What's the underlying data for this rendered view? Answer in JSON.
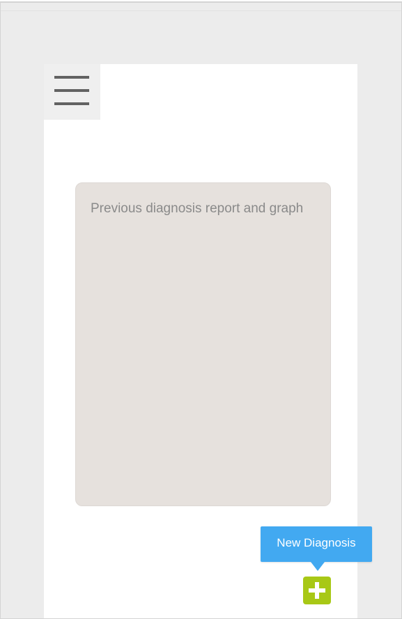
{
  "menu": {
    "icon": "hamburger-menu-icon"
  },
  "report": {
    "placeholder_text": "Previous diagnosis report and graph"
  },
  "new_diagnosis": {
    "tooltip_label": "New Diagnosis",
    "button_icon": "plus-icon"
  },
  "colors": {
    "tooltip": "#42a9f1",
    "add_button": "#a8c816",
    "panel": "#e6e1dd"
  }
}
